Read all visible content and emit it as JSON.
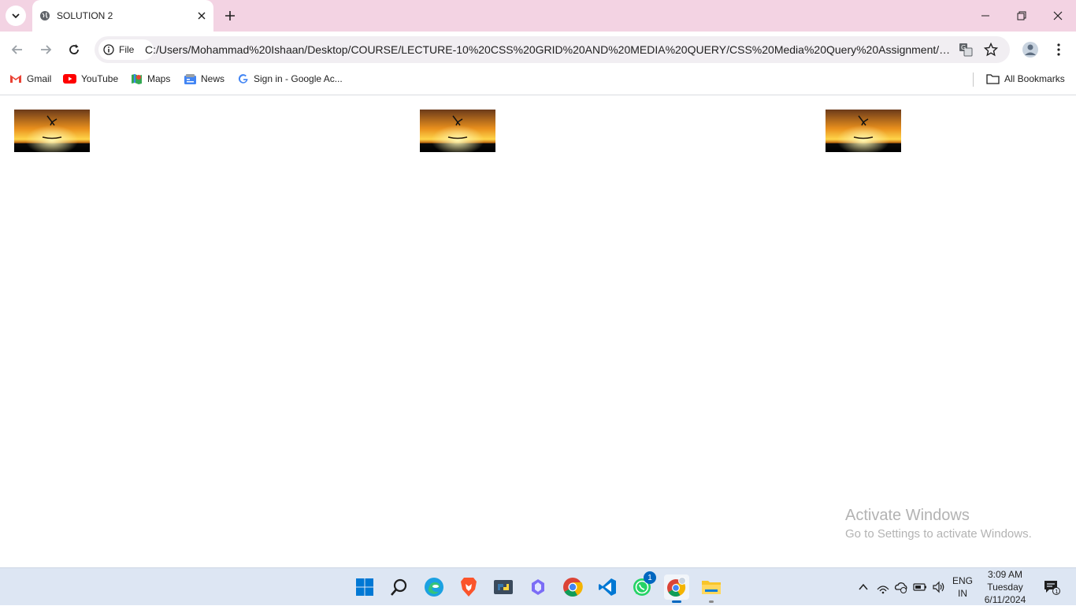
{
  "browser": {
    "tab": {
      "title": "SOLUTION 2",
      "close_label": "×"
    },
    "new_tab_label": "+",
    "address": {
      "scheme_label": "File",
      "url": "C:/Users/Mohammad%20Ishaan/Desktop/COURSE/LECTURE-10%20CSS%20GRID%20AND%20MEDIA%20QUERY/CSS%20Media%20Query%20Assignment/SOLUTIO..."
    },
    "bookmarks": [
      {
        "label": "Gmail",
        "icon": "gmail-icon"
      },
      {
        "label": "YouTube",
        "icon": "youtube-icon"
      },
      {
        "label": "Maps",
        "icon": "maps-icon"
      },
      {
        "label": "News",
        "icon": "news-icon"
      },
      {
        "label": "Sign in - Google Ac...",
        "icon": "google-icon"
      }
    ],
    "all_bookmarks_label": "All Bookmarks"
  },
  "page": {
    "images": [
      {
        "alt": "sunset-image"
      },
      {
        "alt": "sunset-image"
      },
      {
        "alt": "sunset-image"
      }
    ]
  },
  "watermark": {
    "title": "Activate Windows",
    "subtitle": "Go to Settings to activate Windows."
  },
  "taskbar": {
    "apps": [
      "start-icon",
      "search-icon",
      "edge-icon",
      "brave-icon",
      "python-icon",
      "copilot-icon",
      "chrome-icon",
      "vscode-icon",
      "whatsapp-icon",
      "chrome-profile-icon",
      "file-explorer-icon"
    ],
    "whatsapp_badge": "1",
    "lang_top": "ENG",
    "lang_bottom": "IN",
    "time": "3:09 AM",
    "day": "Tuesday",
    "date": "6/11/2024",
    "notification_count": "1"
  },
  "colors": {
    "tabstrip": "#f3d3e3",
    "omnibox": "#f1eef2",
    "taskbar": "#dde6f3",
    "accent": "#0067c0"
  }
}
